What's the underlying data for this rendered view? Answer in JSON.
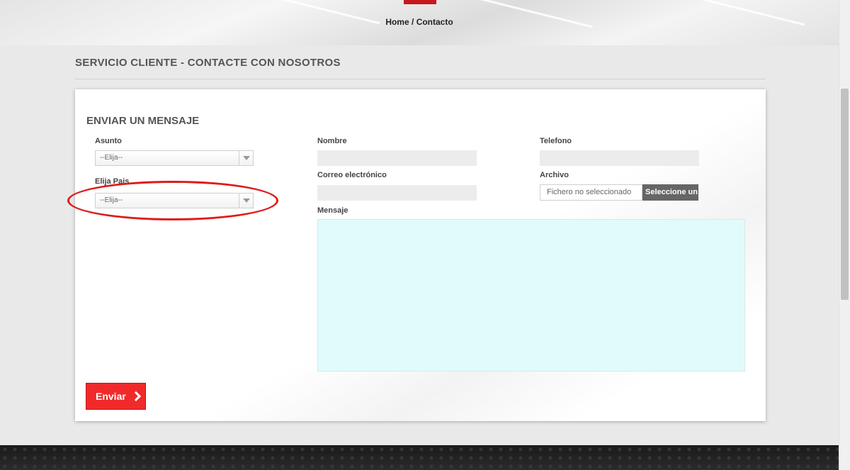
{
  "breadcrumb": {
    "home": "Home",
    "separator": "/",
    "current": "Contacto"
  },
  "page_title": "SERVICIO CLIENTE - CONTACTE CON NOSOTROS",
  "form": {
    "title": "ENVIAR UN MENSAJE",
    "asunto": {
      "label": "Asunto",
      "selected": "--Elija--"
    },
    "pais": {
      "label": "Elija Pais",
      "selected": "--Elija--"
    },
    "nombre": {
      "label": "Nombre",
      "value": ""
    },
    "correo": {
      "label": "Correo electrónico",
      "value": ""
    },
    "telefono": {
      "label": "Telefono",
      "value": ""
    },
    "archivo": {
      "label": "Archivo",
      "file_name": "Fichero no seleccionado",
      "button": "Seleccione un"
    },
    "mensaje": {
      "label": "Mensaje",
      "value": ""
    },
    "submit": "Enviar"
  },
  "icons": {
    "submit_icon": "chevron-right-icon",
    "select_icon": "chevron-down-icon"
  },
  "colors": {
    "accent": "#c8161d",
    "submit_bg": "#f02a2a",
    "highlight": "#e01b1b",
    "message_bg": "#e1fbfb"
  }
}
